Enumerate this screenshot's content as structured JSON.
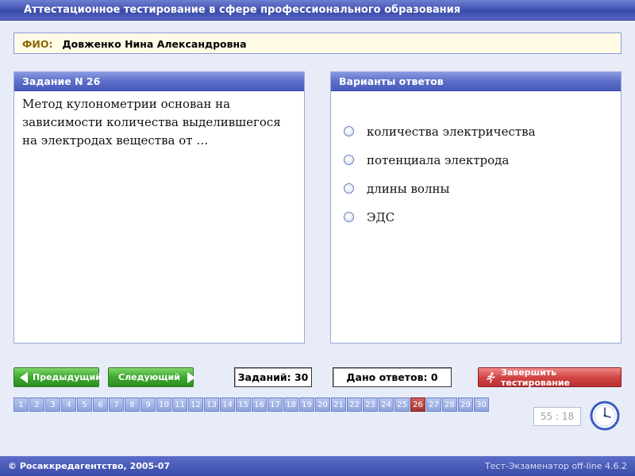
{
  "window": {
    "title": "Аттестационное тестирование в сфере профессионального образования"
  },
  "user": {
    "fio_label": "ФИО:",
    "fio_value": "Довженко Нина Александровна"
  },
  "question": {
    "header": "Задание N 26",
    "text": "Метод кулонометрии основан на зависимости количества выделившегося на электродах вещества от …"
  },
  "answers": {
    "header": "Варианты ответов",
    "options": [
      {
        "label": "количества электричества"
      },
      {
        "label": "потенциала электрода"
      },
      {
        "label": "длины волны"
      },
      {
        "label": "ЭДС"
      }
    ]
  },
  "nav": {
    "prev_label": "Предыдущий",
    "next_label": "Следующий",
    "tasks_count": "Заданий: 30",
    "answered_count": "Дано ответов: 0",
    "finish_label": "Завершить тестирование"
  },
  "question_numbers": [
    "1",
    "2",
    "3",
    "4",
    "5",
    "6",
    "7",
    "8",
    "9",
    "10",
    "11",
    "12",
    "13",
    "14",
    "15",
    "16",
    "17",
    "18",
    "19",
    "20",
    "21",
    "22",
    "23",
    "24",
    "25",
    "26",
    "27",
    "28",
    "29",
    "30"
  ],
  "current_question": "26",
  "timer": {
    "value": "55 : 18"
  },
  "footer": {
    "copyright": "© Росаккредагентство, 2005-07",
    "version": "Тест-Экзаменатор off-line 4.6.2"
  },
  "colors": {
    "primary": "#4656b4",
    "fio_label": "#8a6a00",
    "nav_green": "#3ea82f",
    "finish_red": "#d34545",
    "current_question": "#a53535"
  }
}
